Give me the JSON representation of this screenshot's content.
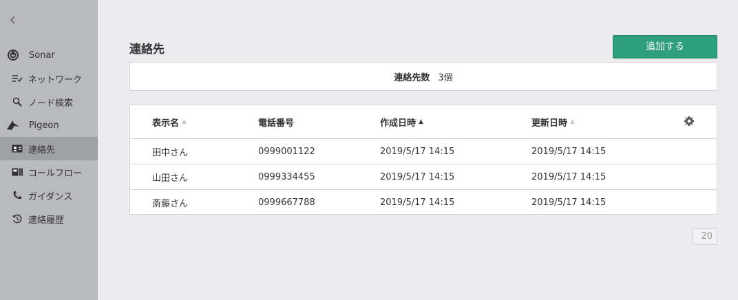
{
  "sidebar": {
    "collapse_icon": "chevron-left-icon",
    "items": [
      {
        "label": "Sonar",
        "icon": "sonar-icon",
        "level": "top"
      },
      {
        "label": "ネットワーク",
        "icon": "network-list-icon",
        "level": "sub"
      },
      {
        "label": "ノード検索",
        "icon": "search-icon",
        "level": "sub"
      },
      {
        "label": "Pigeon",
        "icon": "pigeon-icon",
        "level": "top"
      },
      {
        "label": "連絡先",
        "icon": "contact-card-icon",
        "level": "sub",
        "active": true
      },
      {
        "label": "コールフロー",
        "icon": "callflow-icon",
        "level": "sub"
      },
      {
        "label": "ガイダンス",
        "icon": "phone-icon",
        "level": "sub"
      },
      {
        "label": "連絡履歴",
        "icon": "history-icon",
        "level": "sub"
      }
    ]
  },
  "main": {
    "title": "連絡先",
    "add_button": "追加する",
    "count_label": "連絡先数",
    "count_value": "3個",
    "table": {
      "columns": [
        "表示名",
        "電話番号",
        "作成日時",
        "更新日時"
      ],
      "rows": [
        [
          "田中さん",
          "0999001122",
          "2019/5/17 14:15",
          "2019/5/17 14:15"
        ],
        [
          "山田さん",
          "0999334455",
          "2019/5/17 14:15",
          "2019/5/17 14:15"
        ],
        [
          "斎藤さん",
          "0999667788",
          "2019/5/17 14:15",
          "2019/5/17 14:15"
        ]
      ]
    },
    "page_size": "20"
  },
  "colors": {
    "accent": "#2e9e7b",
    "sidebar": "#b9b9c0",
    "sidebar_active": "#a0a0a8",
    "background": "#ebebf0"
  }
}
